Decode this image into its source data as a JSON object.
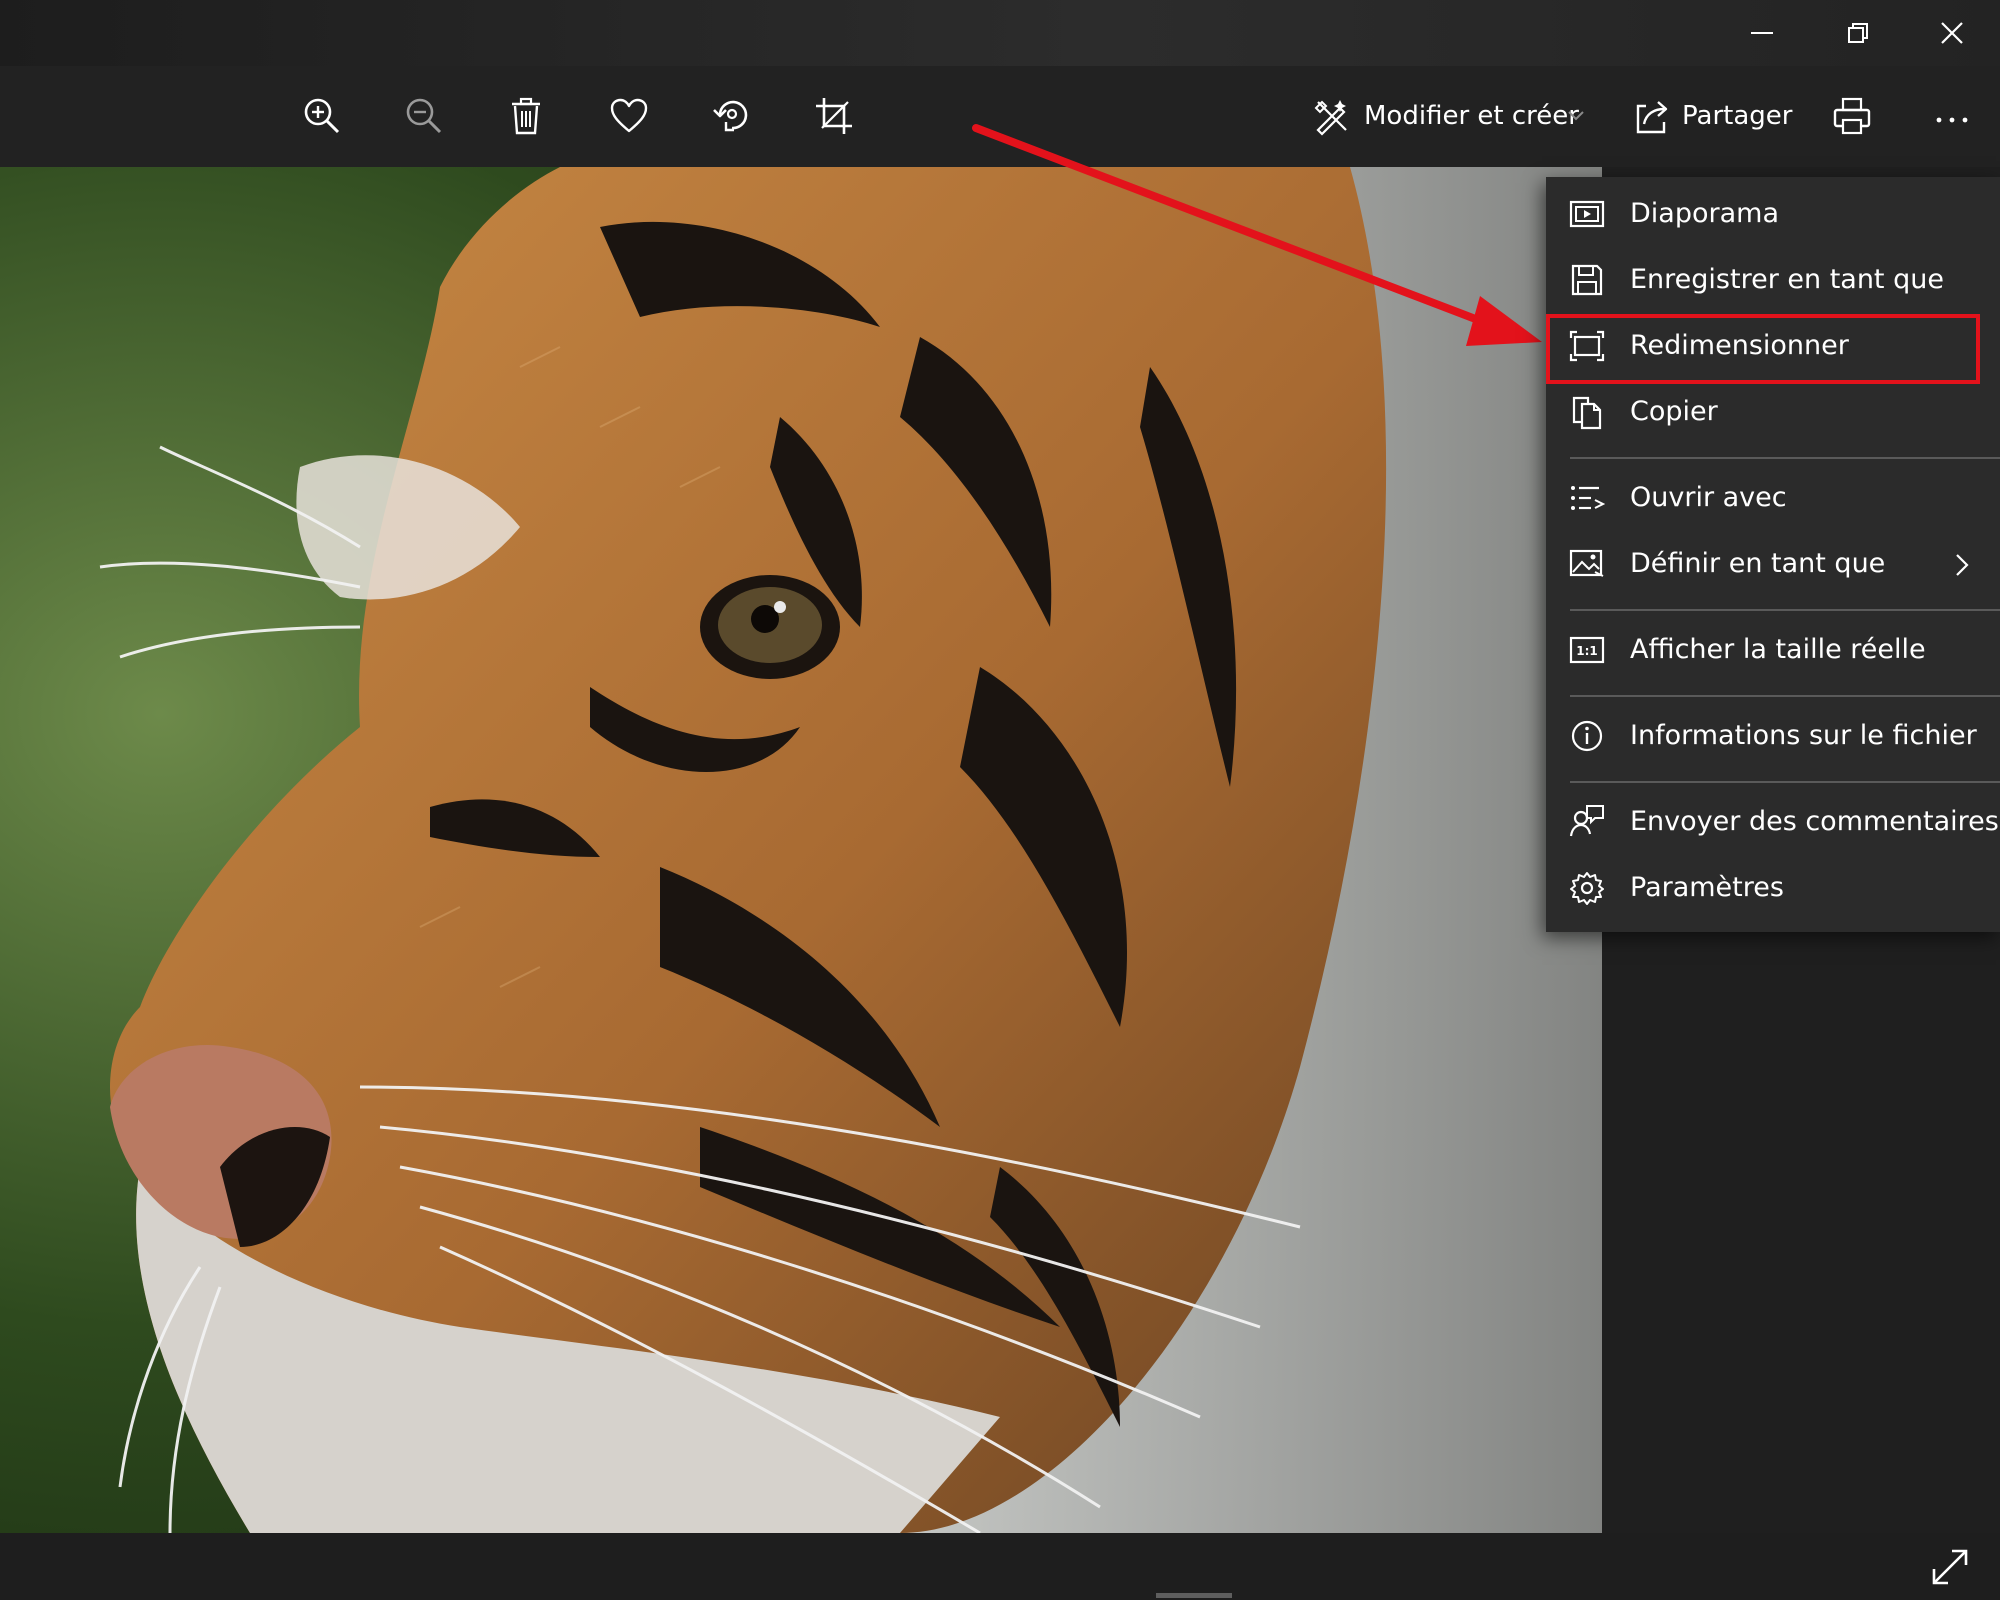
{
  "window": {
    "controls": [
      "minimize-icon",
      "restore-icon",
      "close-icon"
    ]
  },
  "toolbar": {
    "icons": [
      "zoom-in-icon",
      "zoom-out-icon",
      "delete-icon",
      "heart-icon",
      "rotate-icon",
      "crop-icon"
    ],
    "edit_label": "Modifier et créer",
    "share_label": "Partager"
  },
  "menu": {
    "items": [
      {
        "label": "Diaporama",
        "icon": "slideshow-icon"
      },
      {
        "label": "Enregistrer en tant que",
        "icon": "save-icon"
      },
      {
        "label": "Redimensionner",
        "icon": "resize-icon"
      },
      {
        "label": "Copier",
        "icon": "copy-icon"
      },
      {
        "label": "Ouvrir avec",
        "icon": "open-with-icon"
      },
      {
        "label": "Définir en tant que",
        "icon": "set-as-icon"
      },
      {
        "label": "Afficher la taille réelle",
        "icon": "actual-size-icon",
        "icon_text": "1:1"
      },
      {
        "label": "Informations sur le fichier",
        "icon": "info-icon"
      },
      {
        "label": "Envoyer des commentaires",
        "icon": "feedback-icon"
      },
      {
        "label": "Paramètres",
        "icon": "settings-icon"
      }
    ]
  },
  "annotation": {
    "highlight_color": "#e3121b",
    "highlighted_item": "Redimensionner"
  },
  "colors": {
    "titlebar": "#262626",
    "toolbar": "#222222",
    "menu": "#2b2b2b",
    "text": "#ffffff"
  }
}
